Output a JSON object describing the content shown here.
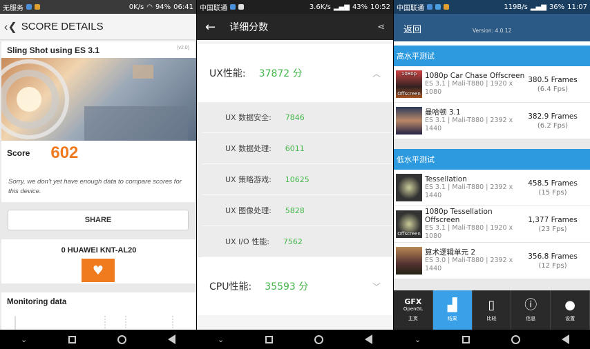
{
  "p1": {
    "status": {
      "carrier": "无服务",
      "net": "0K/s",
      "battery": "94%",
      "time": "06:41"
    },
    "header_title": "SCORE DETAILS",
    "test_name": "Sling Shot using ES 3.1",
    "version_badge": "(v2.0)",
    "score_label": "Score",
    "score_value": "602",
    "sorry_text": "Sorry, we don't yet have enough data to compare scores for this device.",
    "share_label": "SHARE",
    "device_name": "0 HUAWEI KNT-AL20",
    "monitoring_title": "Monitoring data"
  },
  "p2": {
    "status": {
      "carrier": "中国联通",
      "net": "3.6K/s",
      "battery": "43%",
      "time": "10:52"
    },
    "header_title": "详细分数",
    "ux_label": "UX性能:",
    "ux_value": "37872 分",
    "ux_items": [
      {
        "label": "UX 数据安全:",
        "value": "7846"
      },
      {
        "label": "UX 数据处理:",
        "value": "6011"
      },
      {
        "label": "UX 策略游戏:",
        "value": "10625"
      },
      {
        "label": "UX 图像处理:",
        "value": "5828"
      },
      {
        "label": "UX I/O 性能:",
        "value": "7562"
      }
    ],
    "cpu_label": "CPU性能:",
    "cpu_value": "35593 分"
  },
  "p3": {
    "status": {
      "carrier": "中国联通",
      "net": "119B/s",
      "battery": "36%",
      "time": "11:07"
    },
    "back_label": "返回",
    "version": "Version: 4.0.12",
    "section_high": "高水平测试",
    "section_low": "低水平测试",
    "high": [
      {
        "name": "1080p Car Chase Offscreen",
        "sub": "ES 3.1 | Mali-T880 | 1920 x 1080",
        "frames": "380.5 Frames",
        "fps": "(6.4 Fps)",
        "tag": "1080p",
        "tag2": "Offscreen"
      },
      {
        "name": "曼哈顿 3.1",
        "sub": "ES 3.1 | Mali-T880 | 2392 x 1440",
        "frames": "382.9 Frames",
        "fps": "(6.2 Fps)"
      }
    ],
    "low": [
      {
        "name": "Tessellation",
        "sub": "ES 3.1 | Mali-T880 | 2392 x 1440",
        "frames": "458.5 Frames",
        "fps": "(15 Fps)"
      },
      {
        "name": "1080p Tessellation Offscreen",
        "sub": "ES 3.1 | Mali-T880 | 1920 x 1080",
        "frames": "1,377 Frames",
        "fps": "(23 Fps)",
        "tag2": "Offscreen"
      },
      {
        "name": "算术逻辑单元 2",
        "sub": "ES 3.0 | Mali-T880 | 2392 x 1440",
        "frames": "356.8 Frames",
        "fps": "(12 Fps)"
      }
    ],
    "tabs": [
      {
        "label": "主页",
        "gfx": "GFX",
        "gfx_sub": "OpenGL"
      },
      {
        "label": "结果"
      },
      {
        "label": "比较"
      },
      {
        "label": "信息"
      },
      {
        "label": "设置"
      }
    ]
  }
}
